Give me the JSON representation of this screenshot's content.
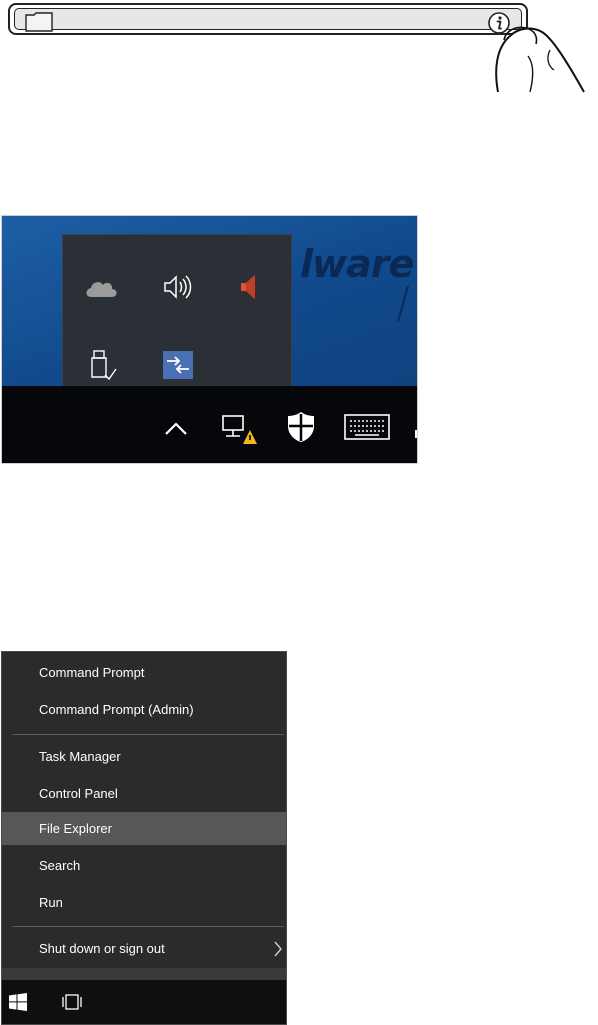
{
  "address_bar": {
    "folder_icon": "folder-icon",
    "info_icon": "info-icon"
  },
  "tray": {
    "background_wordmark": "lware",
    "overflow_icons": [
      "cloud-icon",
      "speaker-icon",
      "mute-speaker-icon",
      "usb-drive-icon",
      "app-arrows-icon"
    ],
    "taskbar_icons": [
      "chevron-up-icon",
      "network-warning-icon",
      "security-shield-icon",
      "keyboard-icon"
    ]
  },
  "winx_menu": {
    "items": [
      {
        "label": "Command Prompt"
      },
      {
        "label": "Command Prompt (Admin)"
      },
      {
        "label": "Task Manager"
      },
      {
        "label": "Control Panel"
      },
      {
        "label": "File Explorer"
      },
      {
        "label": "Search"
      },
      {
        "label": "Run"
      },
      {
        "label": "Shut down or sign out"
      }
    ],
    "highlighted": "File Explorer",
    "taskbar_icons": [
      "windows-start-icon",
      "task-view-icon"
    ]
  },
  "colors": {
    "menu_bg": "#2b2b2b",
    "menu_hover": "#575757",
    "taskbar_bg": "#06070a",
    "desktop_blue": "#114a8c"
  }
}
